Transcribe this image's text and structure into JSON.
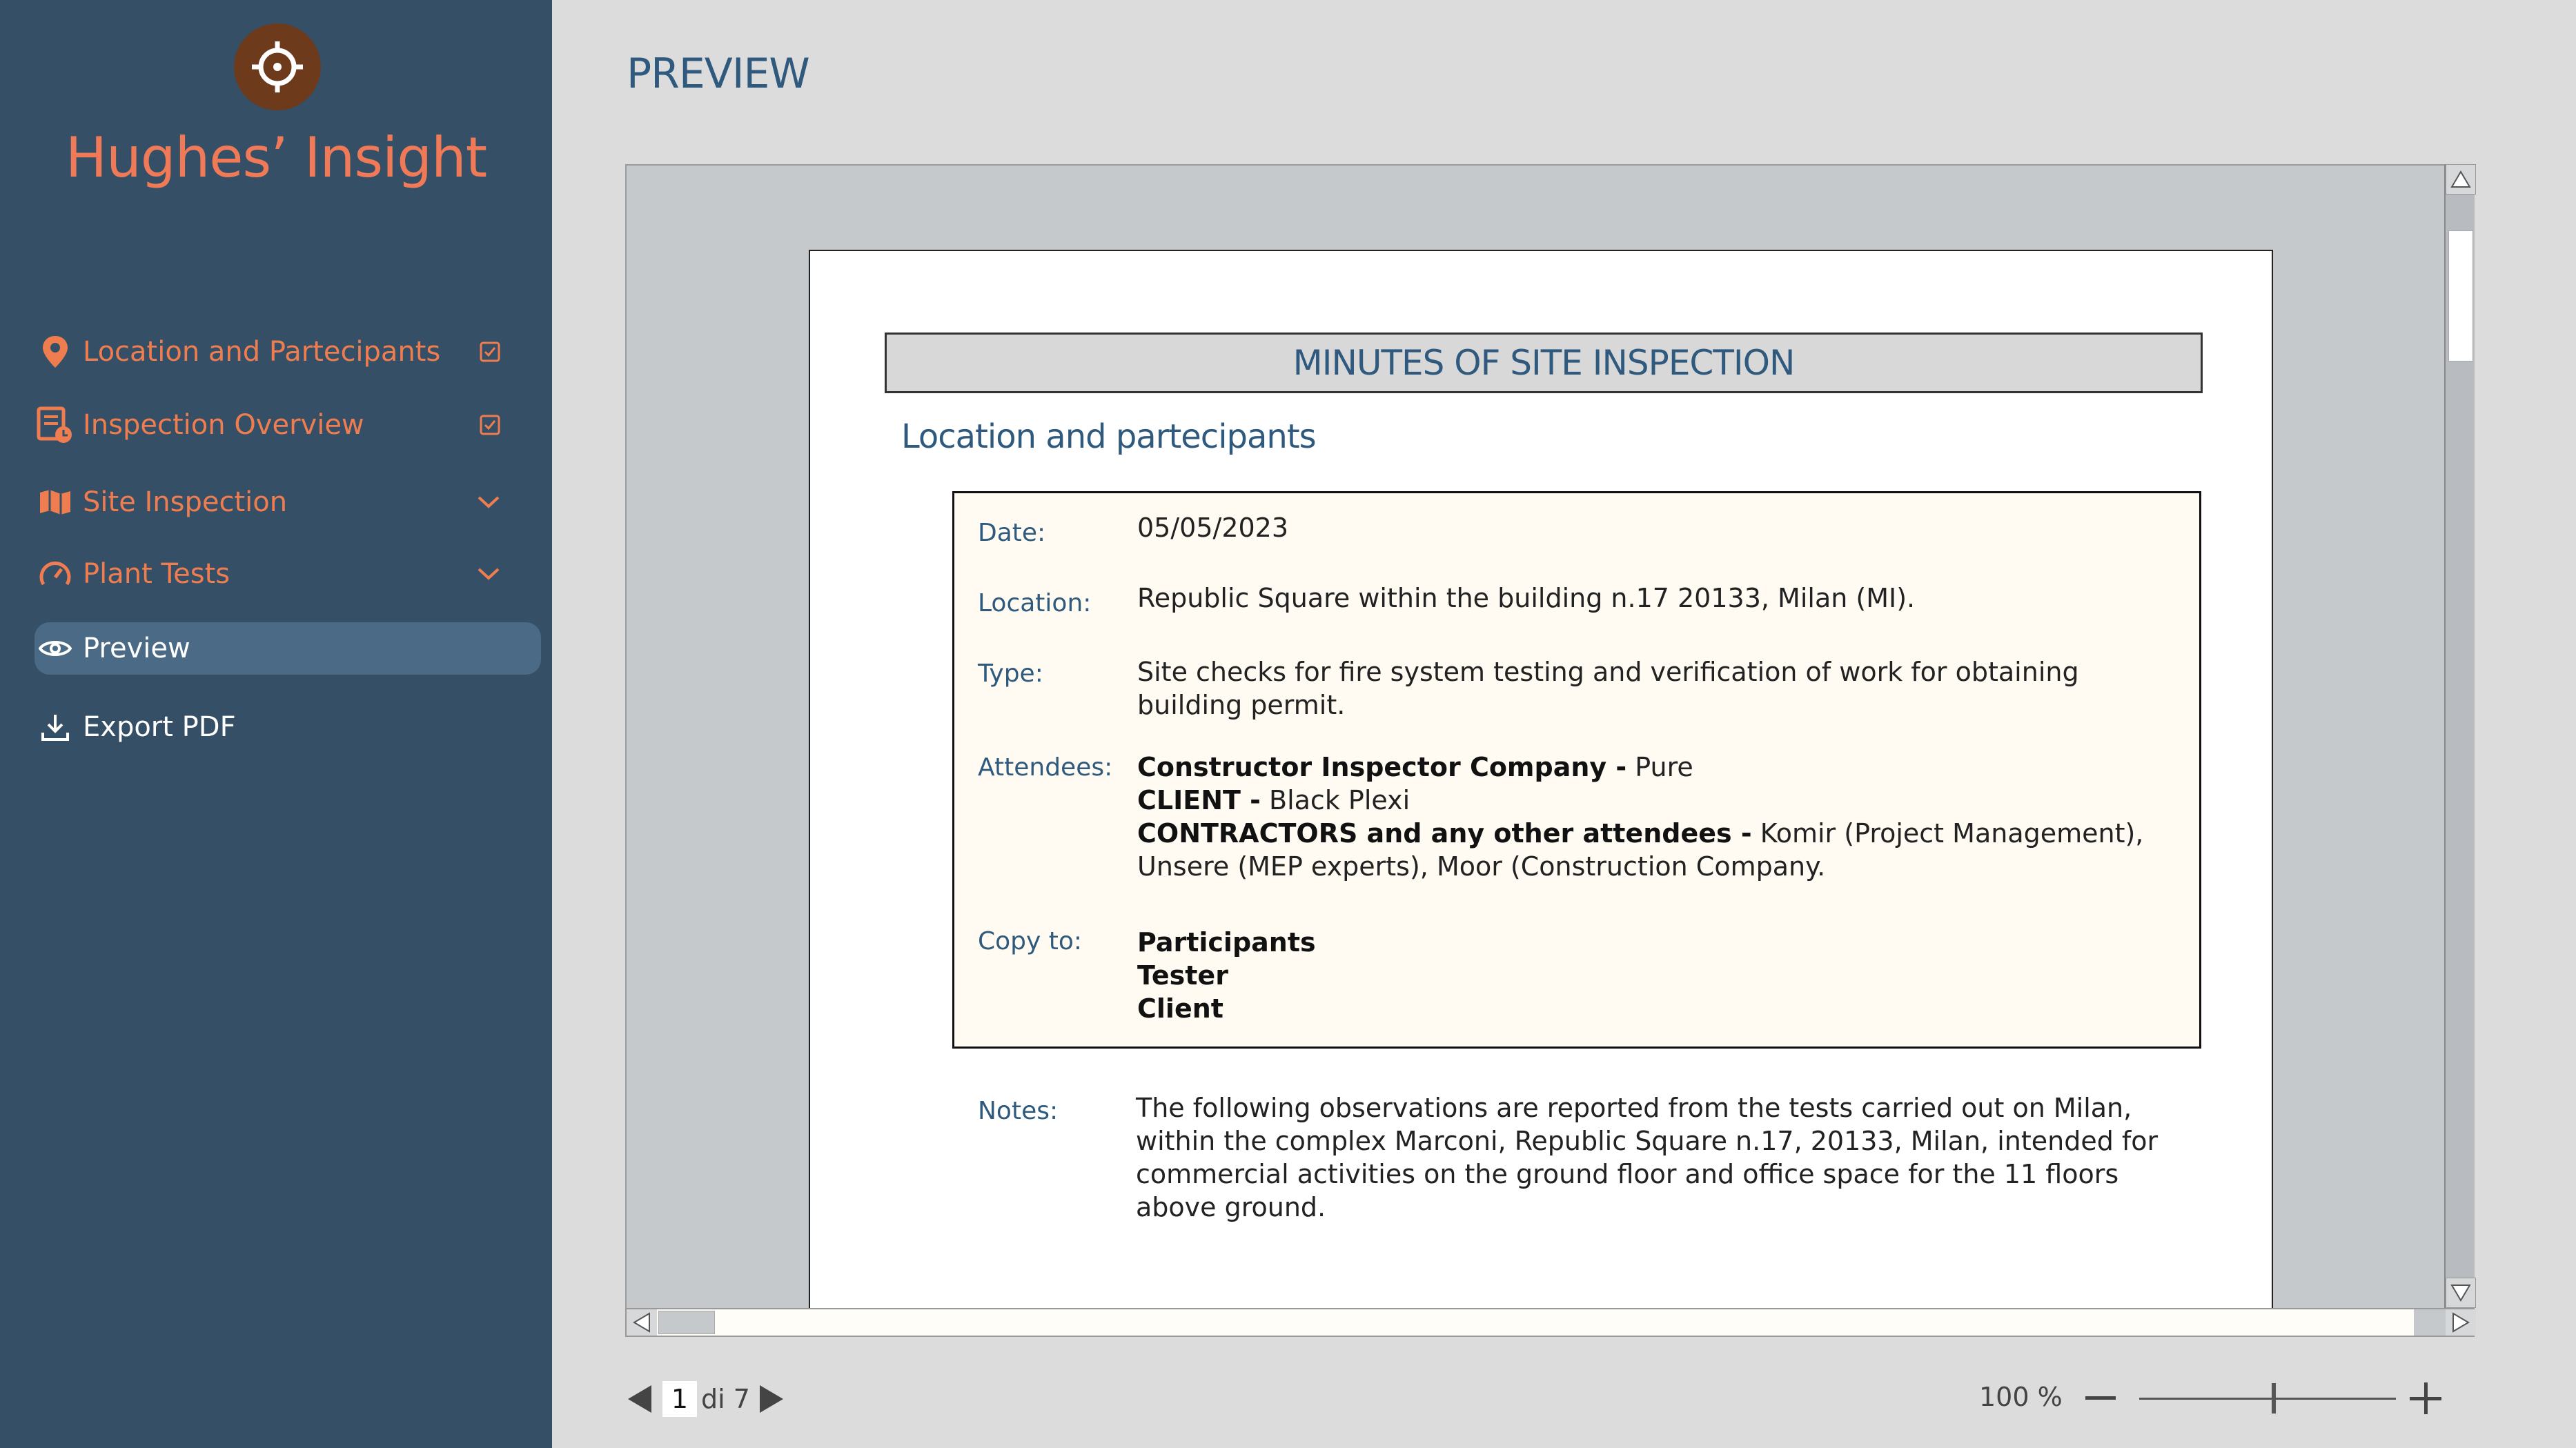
{
  "app": {
    "brand": "Hughes’  Insight",
    "accent_color": "#ef7d4f",
    "sidebar_color": "#354f66"
  },
  "sidebar": {
    "items": [
      {
        "label": "Location and Partecipants",
        "icon": "location-pin-icon",
        "right": "checkbox-checked-icon"
      },
      {
        "label": "Inspection Overview",
        "icon": "report-clock-icon",
        "right": "checkbox-checked-icon"
      },
      {
        "label": "Site Inspection",
        "icon": "map-icon",
        "right": "chevron-down-icon"
      },
      {
        "label": "Plant Tests",
        "icon": "gauge-icon",
        "right": "chevron-down-icon"
      },
      {
        "label": "Preview",
        "icon": "eye-icon",
        "active": true
      },
      {
        "label": "Export PDF",
        "icon": "download-icon"
      }
    ]
  },
  "main": {
    "title": "PREVIEW"
  },
  "document": {
    "title": "MINUTES OF SITE INSPECTION",
    "section": "Location and partecipants",
    "fields": {
      "date_label": "Date:",
      "date_value": "05/05/2023",
      "location_label": "Location:",
      "location_value": "Republic Square within the building n.17 20133, Milan (MI).",
      "type_label": "Type:",
      "type_line1": "Site checks for fire system testing and verification of work for obtaining",
      "type_line2": "building permit.",
      "attendees_label": "Attendees:",
      "att1_bold": "Constructor Inspector Company -",
      "att1_text": " Pure",
      "att2_bold": "CLIENT -",
      "att2_text": " Black Plexi",
      "att3_bold": "CONTRACTORS and any other attendees  -",
      "att3_text": " Komir (Project Management),",
      "att3_line2": "Unsere (MEP experts), Moor (Construction Company.",
      "copy_label": "Copy to:",
      "copy1": "Participants",
      "copy2": "Tester",
      "copy3": "Client",
      "notes_label": "Notes:",
      "notes_line1": "The following observations are reported from the tests carried out on Milan,",
      "notes_line2": "within the complex Marconi, Republic Square n.17, 20133, Milan, intended for",
      "notes_line3": "commercial activities on the ground floor and office space for the 11 floors",
      "notes_line4": "above ground."
    }
  },
  "toolbar": {
    "page_current": "1",
    "page_total_text": "di 7",
    "zoom_label": "100 %",
    "zoom_level_percent": 100
  }
}
